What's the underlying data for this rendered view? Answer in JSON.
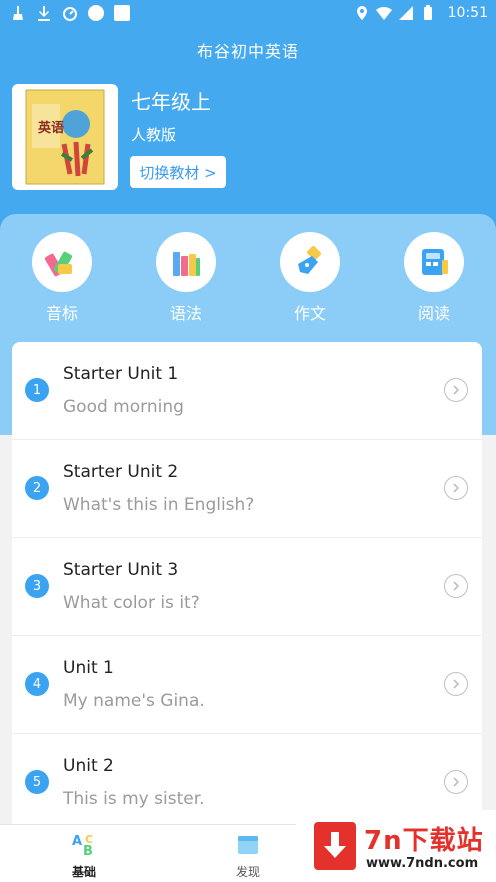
{
  "status": {
    "time": "10:51"
  },
  "app_title": "布谷初中英语",
  "textbook": {
    "cover_text": "英语",
    "grade": "七年级上",
    "edition": "人教版",
    "switch_label": "切换教材 >"
  },
  "functions": [
    {
      "label": "音标",
      "icon": "pencil-crayons-icon"
    },
    {
      "label": "语法",
      "icon": "books-icon"
    },
    {
      "label": "作文",
      "icon": "pen-nib-icon"
    },
    {
      "label": "阅读",
      "icon": "reader-icon"
    }
  ],
  "units": [
    {
      "num": "1",
      "name": "Starter Unit 1",
      "subtitle": "Good morning"
    },
    {
      "num": "2",
      "name": "Starter Unit 2",
      "subtitle": "What's this in English?"
    },
    {
      "num": "3",
      "name": "Starter Unit 3",
      "subtitle": "What color is it?"
    },
    {
      "num": "4",
      "name": "Unit 1",
      "subtitle": "My name's Gina."
    },
    {
      "num": "5",
      "name": "Unit 2",
      "subtitle": "This is my sister."
    }
  ],
  "nav": [
    {
      "label": "基础",
      "active": true
    },
    {
      "label": "发现",
      "active": false
    }
  ],
  "watermark": {
    "title": "7n下载站",
    "url": "www.7ndn.com"
  },
  "colors": {
    "primary": "#45a9f0",
    "panel": "#8ccdf8",
    "badge": "#3aa3f2",
    "watermark": "#e4312b"
  }
}
